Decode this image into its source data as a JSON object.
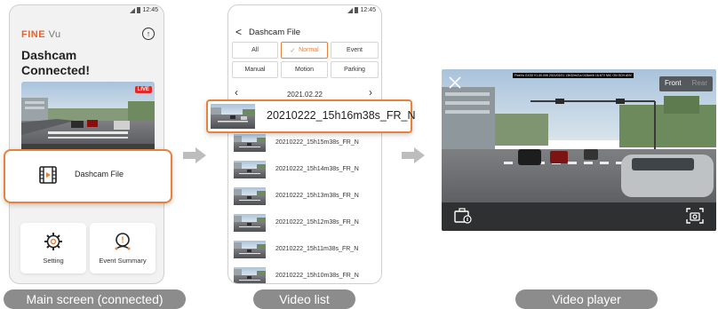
{
  "main_screen": {
    "status_time": "12:45",
    "logo_brand": "FINE",
    "logo_suffix": "Vu",
    "title": "Dashcam\nConnected!",
    "live_badge": "LIVE",
    "dashcam_file_label": "Dashcam File",
    "setting_label": "Setting",
    "event_summary_label": "Event Summary"
  },
  "video_list": {
    "status_time": "12:45",
    "back_icon": "chevron-left-icon",
    "title": "Dashcam File",
    "filters": [
      {
        "label": "All",
        "active": false
      },
      {
        "label": "Normal",
        "active": true
      },
      {
        "label": "Event",
        "active": false
      },
      {
        "label": "Manual",
        "active": false
      },
      {
        "label": "Motion",
        "active": false
      },
      {
        "label": "Parking",
        "active": false
      }
    ],
    "date": "2021.02.22",
    "highlighted_file": "20210222_15h16m38s_FR_N",
    "files": [
      "20210222_15h15m38s_FR_N",
      "20210222_15h14m38s_FR_N",
      "20210222_15h13m38s_FR_N",
      "20210222_15h12m38s_FR_N",
      "20210222_15h11m38s_FR_N",
      "20210222_15h10m38s_FR_N"
    ]
  },
  "player": {
    "overlay_info": "FineVu GX33 V1.00.006  2021/02/21 13h32m21s  013km/h 16.67V MIC ON  SCH ANV",
    "front_label": "Front",
    "rear_label": "Rear"
  },
  "captions": {
    "main": "Main screen (connected)",
    "list": "Video list",
    "player": "Video player"
  },
  "colors": {
    "accent": "#e8823a",
    "live_red": "#e02a2a",
    "caption_bg": "#8c8c8c"
  }
}
